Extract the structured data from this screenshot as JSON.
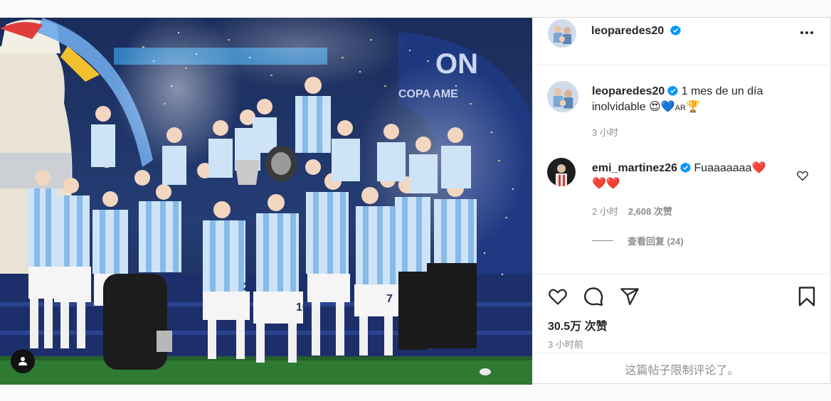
{
  "post": {
    "author": "leoparedes20",
    "photo_alt": "",
    "banner_text": "ON",
    "banner_subtext": "COPA AME",
    "jersey_numbers": [
      "29",
      "10",
      "7"
    ]
  },
  "header": {
    "username": "leoparedes20",
    "verified_icon": "verified-badge-icon",
    "more_icon": "more-options-icon"
  },
  "caption": {
    "username": "leoparedes20",
    "text": "1 mes de un día inolvidable",
    "emoji": "😍💙",
    "flag_text": "AR",
    "trophy": "🏆",
    "time": "3 小时"
  },
  "comments": [
    {
      "username": "emi_martinez26",
      "text": "Fuaaaaaaa",
      "emoji_inline": "❤️",
      "emoji_line2": "❤️❤️",
      "time": "2 小时",
      "likes": "2,608 次赞",
      "replies": "查看回复 (24)"
    }
  ],
  "actions": {
    "like_icon": "heart-icon",
    "comment_icon": "comment-icon",
    "share_icon": "paper-plane-icon",
    "save_icon": "bookmark-icon"
  },
  "likes_text": "30.5万 次赞",
  "posted_time": "3 小时前",
  "comments_limited": "这篇帖子限制评论了。",
  "colors": {
    "accent_blue": "#0095f6",
    "text": "#262626",
    "muted": "#8e8e8e",
    "border": "#dbdbdb"
  }
}
